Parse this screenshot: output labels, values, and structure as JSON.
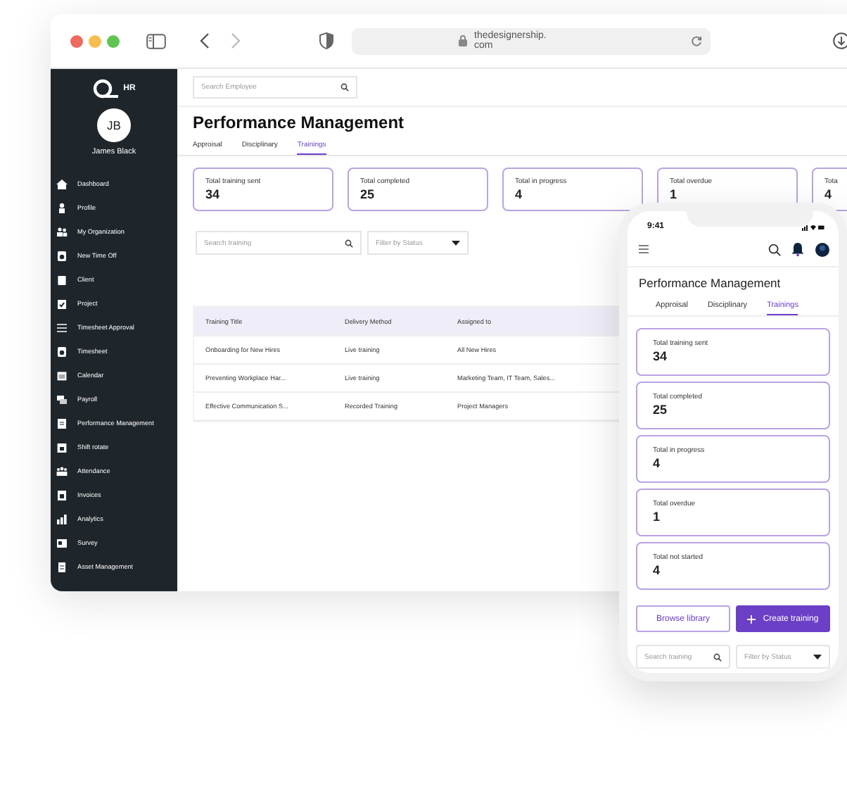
{
  "browser": {
    "url_lines": [
      "thedesignership.",
      "com"
    ]
  },
  "sidebar": {
    "logo": "HR",
    "avatar": "JB",
    "user": "James Black",
    "items": [
      {
        "label": "Dashboard"
      },
      {
        "label": "Profile"
      },
      {
        "label": "My Organization"
      },
      {
        "label": "New Time Off"
      },
      {
        "label": "Client"
      },
      {
        "label": "Project"
      },
      {
        "label": "Timesheet Approval"
      },
      {
        "label": "Timesheet"
      },
      {
        "label": "Calendar"
      },
      {
        "label": "Payroll"
      },
      {
        "label": "Performance Management"
      },
      {
        "label": "Shift rotate"
      },
      {
        "label": "Attendance"
      },
      {
        "label": "Invoices"
      },
      {
        "label": "Analytics"
      },
      {
        "label": "Survey"
      },
      {
        "label": "Asset Management"
      }
    ]
  },
  "main": {
    "employee_search": {
      "placeholder": "Search Employee"
    },
    "title": "Performance Management",
    "tabs": [
      {
        "label": "Approisal",
        "selected": false
      },
      {
        "label": "Disciplinary",
        "selected": false
      },
      {
        "label": "Trainings",
        "selected": true
      }
    ],
    "stats": [
      {
        "label": "Total training sent",
        "value": "34"
      },
      {
        "label": "Total completed",
        "value": "25"
      },
      {
        "label": "Total in progress",
        "value": "4"
      },
      {
        "label": "Total overdue",
        "value": "1"
      },
      {
        "label": "Tota",
        "value": "4"
      }
    ],
    "search": {
      "placeholder": "Search training"
    },
    "filter": "Filter by Status",
    "table": {
      "columns": [
        "Training Title",
        "Delivery Method",
        "Assigned to"
      ],
      "rows": [
        [
          "Onboarding for New Hires",
          "Live training",
          "All New Hires"
        ],
        [
          "Preventing Workplace Har...",
          "Live training",
          "Marketing Team, IT Team, Sales..."
        ],
        [
          "Effective Communication S...",
          "Recorded Training",
          "Project Managers"
        ]
      ]
    }
  },
  "phone": {
    "time": "9:41",
    "title": "Performance Management",
    "tabs": [
      {
        "label": "Approisal",
        "selected": false
      },
      {
        "label": "Disciplinary",
        "selected": false
      },
      {
        "label": "Trainings",
        "selected": true
      }
    ],
    "stats": [
      {
        "label": "Total training sent",
        "value": "34"
      },
      {
        "label": "Total completed",
        "value": "25"
      },
      {
        "label": "Total in progress",
        "value": "4"
      },
      {
        "label": "Total overdue",
        "value": "1"
      },
      {
        "label": "Total not started",
        "value": "4"
      }
    ],
    "buttons": [
      {
        "label": "Browse library",
        "kind": "outline"
      },
      {
        "label": "Create training",
        "kind": "primary"
      }
    ],
    "search": {
      "placeholder": "Search training"
    },
    "filter": "Filter by Status"
  }
}
